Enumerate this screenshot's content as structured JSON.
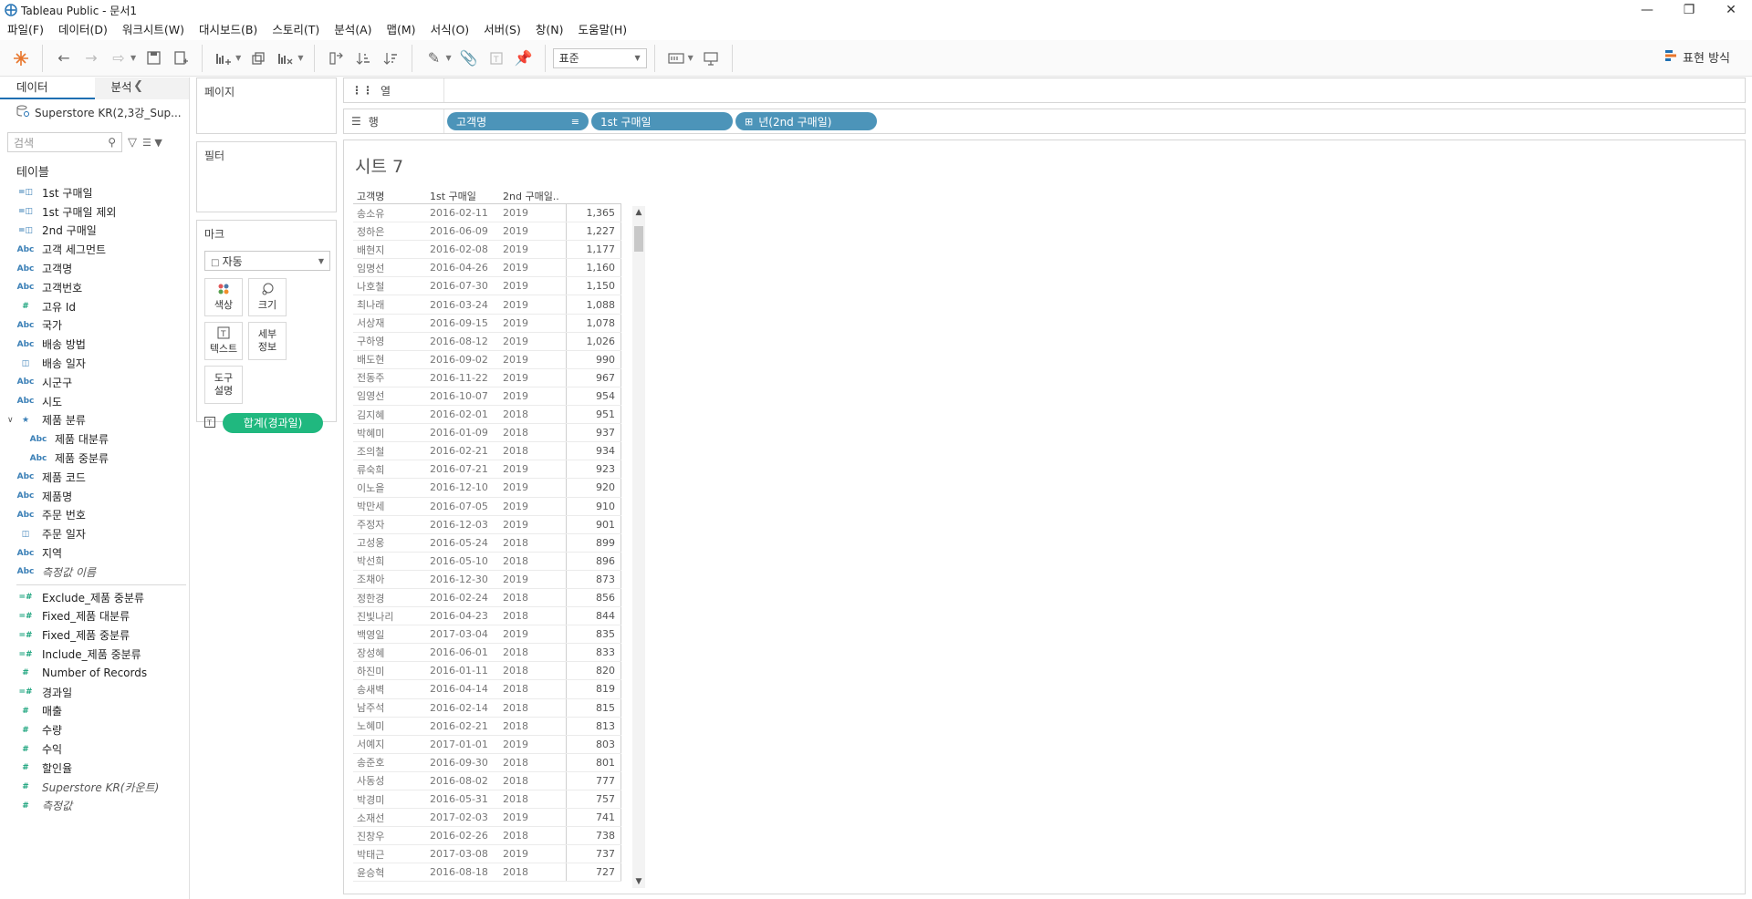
{
  "window": {
    "title": "Tableau Public - 문서1"
  },
  "menu": [
    "파일(F)",
    "데이터(D)",
    "워크시트(W)",
    "대시보드(B)",
    "스토리(T)",
    "분석(A)",
    "맵(M)",
    "서식(O)",
    "서버(S)",
    "창(N)",
    "도움말(H)"
  ],
  "toolbar": {
    "fit_select": "표준",
    "present_label": "표현 방식"
  },
  "data_pane": {
    "tab_data": "데이터",
    "tab_analysis": "분석",
    "datasource": "Superstore KR(2,3강_Sup...",
    "search_placeholder": "검색",
    "section_tables": "테이블",
    "fields": [
      {
        "name": "1st 구매일",
        "icon": "calc-icon"
      },
      {
        "name": "1st 구매일 제외",
        "icon": "calc-icon"
      },
      {
        "name": "2nd 구매일",
        "icon": "calc-icon"
      },
      {
        "name": "고객 세그먼트",
        "icon": "abc"
      },
      {
        "name": "고객명",
        "icon": "abc"
      },
      {
        "name": "고객번호",
        "icon": "abc"
      },
      {
        "name": "고유 Id",
        "icon": "hash"
      },
      {
        "name": "국가",
        "icon": "abc"
      },
      {
        "name": "배송 방법",
        "icon": "abc"
      },
      {
        "name": "배송 일자",
        "icon": "date"
      },
      {
        "name": "시군구",
        "icon": "abc"
      },
      {
        "name": "시도",
        "icon": "abc"
      },
      {
        "name": "제품 분류",
        "icon": "hier",
        "expander": true
      },
      {
        "name": "제품 대분류",
        "icon": "abc",
        "indent": true
      },
      {
        "name": "제품 중분류",
        "icon": "abc",
        "indent": true
      },
      {
        "name": "제품 코드",
        "icon": "abc"
      },
      {
        "name": "제품명",
        "icon": "abc"
      },
      {
        "name": "주문 번호",
        "icon": "abc"
      },
      {
        "name": "주문 일자",
        "icon": "date"
      },
      {
        "name": "지역",
        "icon": "abc"
      },
      {
        "name": "측정값 이름",
        "icon": "abc",
        "italic": true
      }
    ],
    "measures": [
      {
        "name": "Exclude_제품 중분류",
        "icon": "calc-hash"
      },
      {
        "name": "Fixed_제품 대분류",
        "icon": "calc-hash"
      },
      {
        "name": "Fixed_제품 중분류",
        "icon": "calc-hash"
      },
      {
        "name": "Include_제품 중분류",
        "icon": "calc-hash"
      },
      {
        "name": "Number of Records",
        "icon": "hash"
      },
      {
        "name": "경과일",
        "icon": "calc-hash"
      },
      {
        "name": "매출",
        "icon": "hash"
      },
      {
        "name": "수량",
        "icon": "hash"
      },
      {
        "name": "수익",
        "icon": "hash"
      },
      {
        "name": "할인율",
        "icon": "hash"
      },
      {
        "name": "Superstore KR(카운트)",
        "icon": "hash",
        "italic": true
      },
      {
        "name": "측정값",
        "icon": "hash",
        "italic": true
      }
    ]
  },
  "shelves": {
    "pages": "페이지",
    "filters": "필터",
    "marks": "마크",
    "mark_type": "자동",
    "mark_buttons": {
      "color": "색상",
      "size": "크기",
      "text": "텍스트",
      "detail": "세부\n정보",
      "tooltip": "도구\n설명"
    },
    "mark_pill": "합계(경과일)",
    "columns_label": "열",
    "rows_label": "행",
    "row_pills": [
      "고객명",
      "1st 구매일",
      "년(2nd 구매일)"
    ]
  },
  "sheet": {
    "title": "시트 7",
    "headers": [
      "고객명",
      "1st 구매일",
      "2nd 구매일.."
    ],
    "rows": [
      [
        "송소유",
        "2016-02-11",
        "2019",
        "1,365"
      ],
      [
        "정하은",
        "2016-06-09",
        "2019",
        "1,227"
      ],
      [
        "배현지",
        "2016-02-08",
        "2019",
        "1,177"
      ],
      [
        "임명선",
        "2016-04-26",
        "2019",
        "1,160"
      ],
      [
        "나호철",
        "2016-07-30",
        "2019",
        "1,150"
      ],
      [
        "최나래",
        "2016-03-24",
        "2019",
        "1,088"
      ],
      [
        "서상재",
        "2016-09-15",
        "2019",
        "1,078"
      ],
      [
        "구하영",
        "2016-08-12",
        "2019",
        "1,026"
      ],
      [
        "배도현",
        "2016-09-02",
        "2019",
        "990"
      ],
      [
        "전동주",
        "2016-11-22",
        "2019",
        "967"
      ],
      [
        "임영선",
        "2016-10-07",
        "2019",
        "954"
      ],
      [
        "김지혜",
        "2016-02-01",
        "2018",
        "951"
      ],
      [
        "박혜미",
        "2016-01-09",
        "2018",
        "937"
      ],
      [
        "조의철",
        "2016-02-21",
        "2018",
        "934"
      ],
      [
        "류숙희",
        "2016-07-21",
        "2019",
        "923"
      ],
      [
        "이노을",
        "2016-12-10",
        "2019",
        "920"
      ],
      [
        "박만세",
        "2016-07-05",
        "2019",
        "910"
      ],
      [
        "주정자",
        "2016-12-03",
        "2019",
        "901"
      ],
      [
        "고성웅",
        "2016-05-24",
        "2018",
        "899"
      ],
      [
        "박선희",
        "2016-05-10",
        "2018",
        "896"
      ],
      [
        "조채아",
        "2016-12-30",
        "2019",
        "873"
      ],
      [
        "정한경",
        "2016-02-24",
        "2018",
        "856"
      ],
      [
        "진빛나리",
        "2016-04-23",
        "2018",
        "844"
      ],
      [
        "백영일",
        "2017-03-04",
        "2019",
        "835"
      ],
      [
        "장성혜",
        "2016-06-01",
        "2018",
        "833"
      ],
      [
        "하진미",
        "2016-01-11",
        "2018",
        "820"
      ],
      [
        "송새벽",
        "2016-04-14",
        "2018",
        "819"
      ],
      [
        "남주석",
        "2016-02-14",
        "2018",
        "815"
      ],
      [
        "노혜미",
        "2016-02-21",
        "2018",
        "813"
      ],
      [
        "서예지",
        "2017-01-01",
        "2019",
        "803"
      ],
      [
        "송준호",
        "2016-09-30",
        "2018",
        "801"
      ],
      [
        "사동성",
        "2016-08-02",
        "2018",
        "777"
      ],
      [
        "박경미",
        "2016-05-31",
        "2018",
        "757"
      ],
      [
        "소재선",
        "2017-02-03",
        "2019",
        "741"
      ],
      [
        "진창우",
        "2016-02-26",
        "2018",
        "738"
      ],
      [
        "박태근",
        "2017-03-08",
        "2019",
        "737"
      ],
      [
        "윤승혁",
        "2016-08-18",
        "2018",
        "727"
      ]
    ]
  }
}
